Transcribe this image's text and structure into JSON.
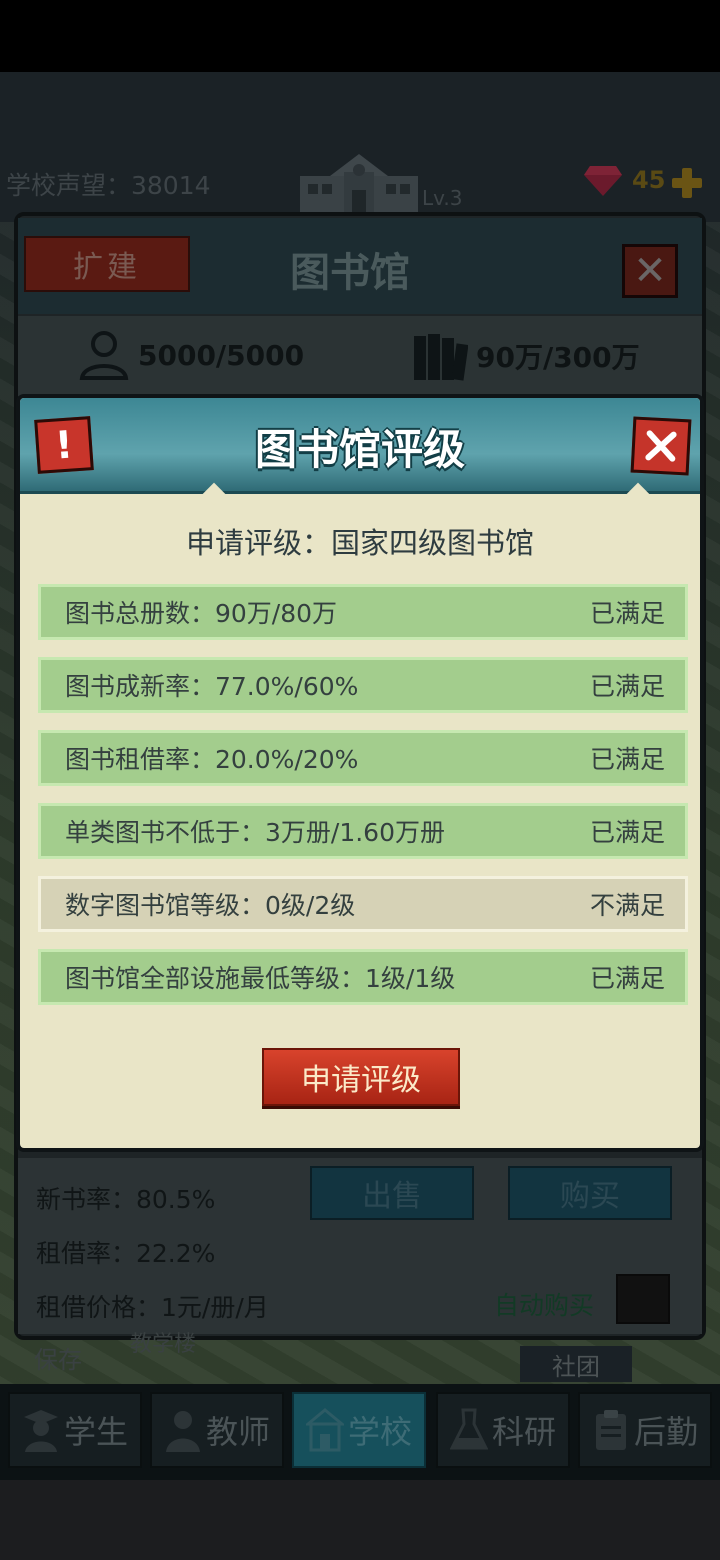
{
  "hud": {
    "reputation": "学校声望：38014",
    "level": "Lv.3",
    "gems": "45"
  },
  "library_panel": {
    "expand_label": "扩建",
    "title": "图书馆",
    "capacity": "5000/5000",
    "books": "90万/300万",
    "new_rate": "新书率：80.5%",
    "borrow_rate": "租借率：22.2%",
    "borrow_price": "租借价格：1元/册/月",
    "sell_label": "出售",
    "buy_label": "购买",
    "auto_buy_label": "自动购买"
  },
  "map": {
    "save_label": "保存",
    "label_a": "教学楼",
    "label_b": "社团"
  },
  "modal": {
    "title": "图书馆评级",
    "apply_line": "申请评级：国家四级图书馆",
    "requirements": [
      {
        "label": "图书总册数：90万/80万",
        "status": "已满足",
        "met": true
      },
      {
        "label": "图书成新率：77.0%/60%",
        "status": "已满足",
        "met": true
      },
      {
        "label": "图书租借率：20.0%/20%",
        "status": "已满足",
        "met": true
      },
      {
        "label": "单类图书不低于：3万册/1.60万册",
        "status": "已满足",
        "met": true
      },
      {
        "label": "数字图书馆等级：0级/2级",
        "status": "不满足",
        "met": false
      },
      {
        "label": "图书馆全部设施最低等级：1级/1级",
        "status": "已满足",
        "met": true
      }
    ],
    "apply_button": "申请评级"
  },
  "nav": {
    "items": [
      {
        "label": "学生",
        "icon": "student-icon"
      },
      {
        "label": "教师",
        "icon": "teacher-icon"
      },
      {
        "label": "学校",
        "icon": "school-icon"
      },
      {
        "label": "科研",
        "icon": "flask-icon"
      },
      {
        "label": "后勤",
        "icon": "clipboard-icon"
      }
    ],
    "active": "学校"
  },
  "colors": {
    "modal_bg": "#e9e5c7",
    "row_met": "#a3cd8d",
    "row_unmet": "#d6d2b6",
    "header_teal": "#4f97a2",
    "button_red": "#c2331f"
  }
}
